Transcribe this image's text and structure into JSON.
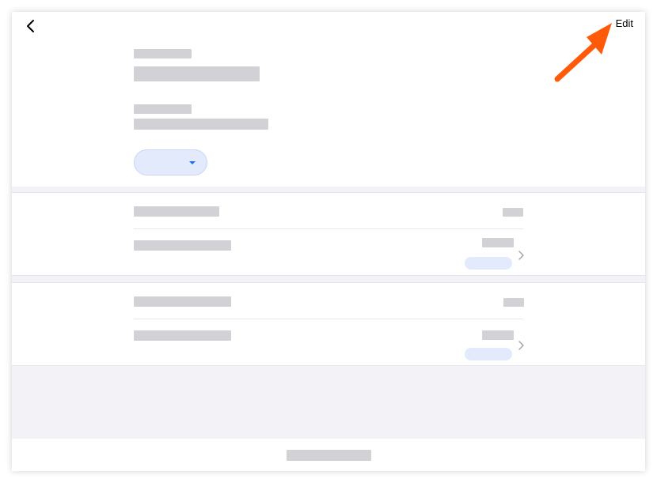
{
  "header": {
    "edit_label": "Edit",
    "back_icon": "chevron-left-icon"
  },
  "sections": [
    {
      "row_icon": "chevron-right-icon"
    },
    {
      "row_icon": "chevron-right-icon"
    }
  ],
  "colors": {
    "accent": "#1a73e8",
    "placeholder": "#d1d1d6",
    "pill": "#e3eafb",
    "annotation_arrow": "#ff5a0a",
    "background": "#f2f2f7"
  }
}
